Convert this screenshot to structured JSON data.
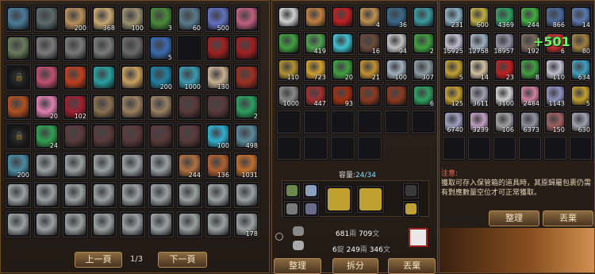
{
  "left_panel": {
    "pager": {
      "prev_label": "上一頁",
      "page_text": "1/3",
      "next_label": "下一頁"
    },
    "slots": [
      {
        "icon": "scroll-icon",
        "c": "#4a7a9a",
        "q": ""
      },
      {
        "icon": "tablet-icon",
        "c": "#5a6a6a",
        "q": ""
      },
      {
        "icon": "scroll-icon",
        "c": "#b8905a",
        "q": "200"
      },
      {
        "icon": "scroll-icon",
        "c": "#c8a870",
        "q": "368"
      },
      {
        "icon": "scroll-icon",
        "c": "#9a9070",
        "q": "100"
      },
      {
        "icon": "coin-icon",
        "c": "#4a8a3a",
        "q": "3"
      },
      {
        "icon": "card-icon",
        "c": "#5a7a8a",
        "q": "60"
      },
      {
        "icon": "vase-icon",
        "c": "#6070c0",
        "q": "500"
      },
      {
        "icon": "ticket-icon",
        "c": "#c06080",
        "q": ""
      },
      {
        "icon": "leaf-icon",
        "c": "#6a7a5a",
        "q": ""
      },
      {
        "icon": "pickaxe-icon",
        "c": "#7a7a7a",
        "q": ""
      },
      {
        "icon": "pickaxe-icon",
        "c": "#7a7a7a",
        "q": ""
      },
      {
        "icon": "pickaxe-icon",
        "c": "#7a7a7a",
        "q": ""
      },
      {
        "icon": "hook-icon",
        "c": "#6a6a6a",
        "q": ""
      },
      {
        "icon": "blue-crystal-icon",
        "c": "#3a6ab0",
        "q": "5"
      },
      {
        "icon": "empty",
        "c": "",
        "q": ""
      },
      {
        "icon": "red-bag-icon",
        "c": "#a02020",
        "q": ""
      },
      {
        "icon": "red-bag-icon",
        "c": "#a02020",
        "q": ""
      },
      {
        "icon": "lock",
        "c": "",
        "q": ""
      },
      {
        "icon": "pink-orb-icon",
        "c": "#c05070",
        "q": ""
      },
      {
        "icon": "red-orb-icon",
        "c": "#c04020",
        "q": ""
      },
      {
        "icon": "teal-orb-icon",
        "c": "#2aa0a0",
        "q": ""
      },
      {
        "icon": "scroll-icon",
        "c": "#c8a060",
        "q": ""
      },
      {
        "icon": "gem-icon",
        "c": "#2080a0",
        "q": "200"
      },
      {
        "icon": "pearl-icon",
        "c": "#3a9ab0",
        "q": "1000"
      },
      {
        "icon": "paper-icon",
        "c": "#c8b090",
        "q": "130"
      },
      {
        "icon": "red-bag-icon",
        "c": "#a03020",
        "q": ""
      },
      {
        "icon": "pouch-icon",
        "c": "#b05020",
        "q": ""
      },
      {
        "icon": "fan-icon",
        "c": "#e080b0",
        "q": "20"
      },
      {
        "icon": "red-bag-icon",
        "c": "#a02030",
        "q": "102"
      },
      {
        "icon": "sword-icon",
        "c": "#8a7050",
        "q": ""
      },
      {
        "icon": "sword-icon",
        "c": "#9a8060",
        "q": ""
      },
      {
        "icon": "sword-icon",
        "c": "#9a8060",
        "q": ""
      },
      {
        "icon": "armor-icon",
        "c": "#5a3a3a",
        "q": ""
      },
      {
        "icon": "armor-icon",
        "c": "#5a3a3a",
        "q": ""
      },
      {
        "icon": "jade-icon",
        "c": "#2aa060",
        "q": "2"
      },
      {
        "icon": "lock",
        "c": "",
        "q": ""
      },
      {
        "icon": "green-orb-icon",
        "c": "#30a050",
        "q": "24"
      },
      {
        "icon": "armor-icon",
        "c": "#5a3a3a",
        "q": ""
      },
      {
        "icon": "armor-icon",
        "c": "#5a3a3a",
        "q": ""
      },
      {
        "icon": "armor-icon",
        "c": "#5a3a3a",
        "q": ""
      },
      {
        "icon": "armor-icon",
        "c": "#5a3a3a",
        "q": ""
      },
      {
        "icon": "armor-icon",
        "c": "#5a3a3a",
        "q": ""
      },
      {
        "icon": "cyan-beads-icon",
        "c": "#30b0d0",
        "q": "100"
      },
      {
        "icon": "pearl-icon",
        "c": "#5a8a9a",
        "q": "498"
      },
      {
        "icon": "feather-icon",
        "c": "#4a8aa0",
        "q": "200"
      },
      {
        "icon": "silver-coin-icon",
        "c": "#9aa0a0",
        "q": ""
      },
      {
        "icon": "silver-coin-icon",
        "c": "#9aa0a0",
        "q": ""
      },
      {
        "icon": "silver-coin-icon",
        "c": "#9aa0a0",
        "q": ""
      },
      {
        "icon": "silver-coin-icon",
        "c": "#9aa0a0",
        "q": ""
      },
      {
        "icon": "silver-coin-icon",
        "c": "#9aa0a0",
        "q": ""
      },
      {
        "icon": "book-icon",
        "c": "#b07040",
        "q": "244"
      },
      {
        "icon": "book-icon",
        "c": "#b06030",
        "q": "136"
      },
      {
        "icon": "book-icon",
        "c": "#c07030",
        "q": "1031"
      },
      {
        "icon": "silver-coin-icon",
        "c": "#9aa0a0",
        "q": ""
      },
      {
        "icon": "silver-coin-icon",
        "c": "#9aa0a0",
        "q": ""
      },
      {
        "icon": "silver-coin-icon",
        "c": "#9aa0a0",
        "q": ""
      },
      {
        "icon": "silver-coin-icon",
        "c": "#9aa0a0",
        "q": ""
      },
      {
        "icon": "silver-coin-icon",
        "c": "#9aa0a0",
        "q": ""
      },
      {
        "icon": "silver-coin-icon",
        "c": "#9aa0a0",
        "q": ""
      },
      {
        "icon": "silver-coin-icon",
        "c": "#9aa0a0",
        "q": ""
      },
      {
        "icon": "silver-coin-icon",
        "c": "#9aa0a0",
        "q": ""
      },
      {
        "icon": "silver-coin-icon",
        "c": "#9aa0a0",
        "q": ""
      },
      {
        "icon": "silver-coin-icon",
        "c": "#9aa0a0",
        "q": ""
      },
      {
        "icon": "silver-coin-icon",
        "c": "#9aa0a0",
        "q": ""
      },
      {
        "icon": "silver-coin-icon",
        "c": "#9aa0a0",
        "q": ""
      },
      {
        "icon": "silver-coin-icon",
        "c": "#9aa0a0",
        "q": ""
      },
      {
        "icon": "silver-coin-icon",
        "c": "#9aa0a0",
        "q": ""
      },
      {
        "icon": "silver-coin-icon",
        "c": "#9aa0a0",
        "q": ""
      },
      {
        "icon": "silver-coin-icon",
        "c": "#9aa0a0",
        "q": ""
      },
      {
        "icon": "silver-coin-icon",
        "c": "#9aa0a0",
        "q": ""
      },
      {
        "icon": "silver-coin-icon",
        "c": "#9aa0a0",
        "q": "178"
      }
    ]
  },
  "middle_panel": {
    "slots": [
      {
        "icon": "scroll-icon",
        "c": "#d0d0d0",
        "q": ""
      },
      {
        "icon": "fan-icon",
        "c": "#c08040",
        "q": ""
      },
      {
        "icon": "cherry-icon",
        "c": "#c02020",
        "q": ""
      },
      {
        "icon": "biscuit-icon",
        "c": "#c09050",
        "q": "4"
      },
      {
        "icon": "brush-icon",
        "c": "#3a6a8a",
        "q": "36"
      },
      {
        "icon": "gear-icon",
        "c": "#3a9aa0",
        "q": ""
      },
      {
        "icon": "green-card-icon",
        "c": "#40a040",
        "q": ""
      },
      {
        "icon": "green-card-icon",
        "c": "#50a050",
        "q": "419"
      },
      {
        "icon": "cyan-stone-icon",
        "c": "#40c0d0",
        "q": ""
      },
      {
        "icon": "herb-icon",
        "c": "#6a4a3a",
        "q": "16"
      },
      {
        "icon": "disc-icon",
        "c": "#c0c0c0",
        "q": "94"
      },
      {
        "icon": "jade-icon",
        "c": "#40a040",
        "q": "2"
      },
      {
        "icon": "gold-bar-icon",
        "c": "#b09030",
        "q": "110"
      },
      {
        "icon": "bottle-icon",
        "c": "#d0a030",
        "q": "723"
      },
      {
        "icon": "green-card-icon",
        "c": "#40a040",
        "q": "20"
      },
      {
        "icon": "ledger-icon",
        "c": "#c09030",
        "q": "21"
      },
      {
        "icon": "shuriken-icon",
        "c": "#a0b0c0",
        "q": "100"
      },
      {
        "icon": "gem-icon",
        "c": "#8a9aa0",
        "q": "307"
      },
      {
        "icon": "needle-icon",
        "c": "#8a8a8a",
        "q": "1000"
      },
      {
        "icon": "dagger-icon",
        "c": "#a03030",
        "q": "447"
      },
      {
        "icon": "fire-icon",
        "c": "#a03010",
        "q": "93"
      },
      {
        "icon": "chest-icon",
        "c": "#8a3a20",
        "q": ""
      },
      {
        "icon": "chest-icon",
        "c": "#8a3a20",
        "q": ""
      },
      {
        "icon": "jade-ring-icon",
        "c": "#30a060",
        "q": "6"
      },
      {
        "icon": "empty",
        "c": "",
        "q": ""
      },
      {
        "icon": "empty",
        "c": "",
        "q": ""
      },
      {
        "icon": "empty",
        "c": "",
        "q": ""
      },
      {
        "icon": "empty",
        "c": "",
        "q": ""
      },
      {
        "icon": "empty",
        "c": "",
        "q": ""
      },
      {
        "icon": "empty",
        "c": "",
        "q": ""
      },
      {
        "icon": "empty",
        "c": "",
        "q": ""
      },
      {
        "icon": "empty",
        "c": "",
        "q": ""
      },
      {
        "icon": "empty",
        "c": "",
        "q": ""
      },
      {
        "icon": "empty",
        "c": "",
        "q": ""
      }
    ],
    "capacity_label": "容量:",
    "capacity_value": "24/34",
    "money_top": {
      "amount1": "681",
      "unit1": "兩",
      "amount2": "709",
      "unit2": "文"
    },
    "money_bottom": {
      "amount0": "6",
      "unit0": "錠",
      "amount1": "249",
      "unit1": "兩",
      "amount2": "346",
      "unit2": "文"
    },
    "buttons": {
      "sort_label": "整理",
      "split_label": "拆分",
      "discard_label": "丟棄"
    }
  },
  "right_panel": {
    "plus_text": "+501",
    "slots": [
      {
        "icon": "crystal-icon",
        "c": "#8ab0c0",
        "q": "231"
      },
      {
        "icon": "gold-ticket-icon",
        "c": "#c0b040",
        "q": "600"
      },
      {
        "icon": "jade-icon",
        "c": "#30a060",
        "q": "4369"
      },
      {
        "icon": "green-card-icon",
        "c": "#40b040",
        "q": "244"
      },
      {
        "icon": "gem-icon",
        "c": "#4a6a9a",
        "q": "866"
      },
      {
        "icon": "gem-icon",
        "c": "#5a7ab0",
        "q": "14"
      },
      {
        "icon": "flower-icon",
        "c": "#c0c0d0",
        "q": "15925"
      },
      {
        "icon": "feather-icon",
        "c": "#a0b0c0",
        "q": "12758"
      },
      {
        "icon": "gem-icon",
        "c": "#9090a0",
        "q": "18957"
      },
      {
        "icon": "tea-icon",
        "c": "#7a6a5a",
        "q": "192"
      },
      {
        "icon": "red-gem-icon",
        "c": "#c03030",
        "q": "6"
      },
      {
        "icon": "herb-icon",
        "c": "#a08040",
        "q": "80"
      },
      {
        "icon": "gold-bar-icon",
        "c": "#c0a030",
        "q": "5"
      },
      {
        "icon": "scroll-icon",
        "c": "#d0c0a0",
        "q": "14"
      },
      {
        "icon": "red-orb-icon",
        "c": "#c02020",
        "q": "23"
      },
      {
        "icon": "green-ticket-icon",
        "c": "#40a040",
        "q": "8"
      },
      {
        "icon": "pearl-icon",
        "c": "#c0c0d0",
        "q": "110"
      },
      {
        "icon": "gem-icon",
        "c": "#40a0c0",
        "q": "634"
      },
      {
        "icon": "gold-bar-icon",
        "c": "#c0a030",
        "q": "125"
      },
      {
        "icon": "crystal-icon",
        "c": "#a0a0b0",
        "q": "3611"
      },
      {
        "icon": "pearl-icon",
        "c": "#d0d0d0",
        "q": "3100"
      },
      {
        "icon": "flower-icon",
        "c": "#d080a0",
        "q": "2484"
      },
      {
        "icon": "gem-icon",
        "c": "#9090c0",
        "q": "1143"
      },
      {
        "icon": "gold-bar-icon",
        "c": "#c0a030",
        "q": "5"
      },
      {
        "icon": "crystal-icon",
        "c": "#a0a0c0",
        "q": "6740"
      },
      {
        "icon": "crystal-icon",
        "c": "#c0a0c0",
        "q": "3239"
      },
      {
        "icon": "pearl-icon",
        "c": "#a0a0a0",
        "q": "106"
      },
      {
        "icon": "gem-icon",
        "c": "#9090a0",
        "q": "6373"
      },
      {
        "icon": "fan-icon",
        "c": "#a06060",
        "q": "150"
      },
      {
        "icon": "gem-icon",
        "c": "#a0a0b0",
        "q": "630"
      },
      {
        "icon": "empty",
        "c": "",
        "q": ""
      },
      {
        "icon": "empty",
        "c": "",
        "q": ""
      },
      {
        "icon": "empty",
        "c": "",
        "q": ""
      },
      {
        "icon": "empty",
        "c": "",
        "q": ""
      },
      {
        "icon": "empty",
        "c": "",
        "q": ""
      },
      {
        "icon": "empty",
        "c": "",
        "q": ""
      }
    ],
    "notice_title": "注意:",
    "notice_text": "獲取可存入保管箱的道具時，其原歸屬包裹仍需有對應數量空位才可正常獲取。",
    "buttons": {
      "sort_label": "整理",
      "discard_label": "丟棄"
    }
  }
}
